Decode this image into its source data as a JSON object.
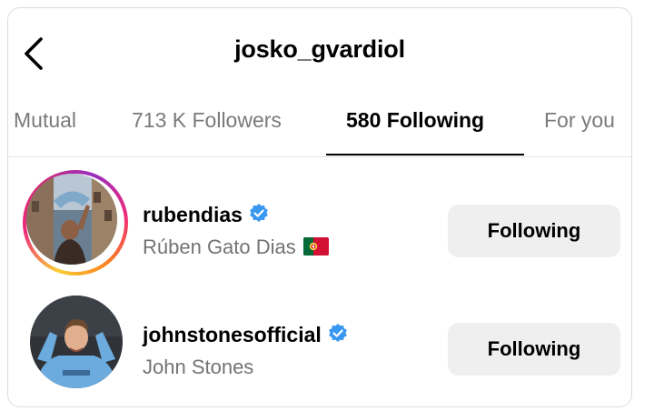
{
  "header": {
    "title": "josko_gvardiol",
    "back_icon": "chevron-left-icon"
  },
  "tabs": [
    {
      "label": "Mutual",
      "active": false
    },
    {
      "label": "713 K Followers",
      "active": false
    },
    {
      "label": "580 Following",
      "active": true
    },
    {
      "label": "For you",
      "active": false
    }
  ],
  "accounts": [
    {
      "username": "rubendias",
      "verified": true,
      "full_name": "Rúben Gato Dias",
      "flag_icon": "portugal-flag-icon",
      "has_story_ring": true,
      "button_label": "Following"
    },
    {
      "username": "johnstonesofficial",
      "verified": true,
      "full_name": "John Stones",
      "has_story_ring": false,
      "button_label": "Following"
    }
  ],
  "colors": {
    "verified_blue": "#3897f0",
    "secondary_text": "#737373",
    "button_bg": "#efefef",
    "active_tab_text": "#000000",
    "inactive_tab_text": "#7a7a7a"
  }
}
